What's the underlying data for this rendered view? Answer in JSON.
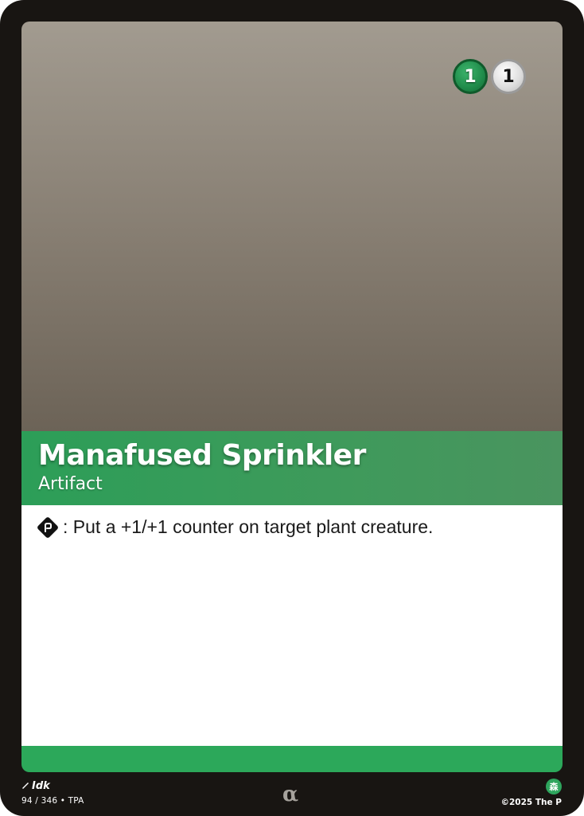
{
  "card": {
    "name": "Manafused Sprinkler",
    "type_line": "Artifact",
    "mana_cost": [
      {
        "value": "1",
        "color": "green"
      },
      {
        "value": "1",
        "color": "white"
      }
    ],
    "rules_text": ": Put a +1/+1 counter on target plant creature.",
    "rules_icon": "tap-icon",
    "artist": "Idk",
    "collector_info": "94 / 346 • TPA",
    "rarity_symbol": "α",
    "set_icon": "森",
    "copyright": "©2025 The P"
  },
  "colors": {
    "frame": "#181512",
    "title_bar": "#2c9e58",
    "bottom_bar": "#2ca85a",
    "text_box": "#ffffff",
    "art_top": "#a29b90",
    "art_bottom": "#6c6357"
  }
}
